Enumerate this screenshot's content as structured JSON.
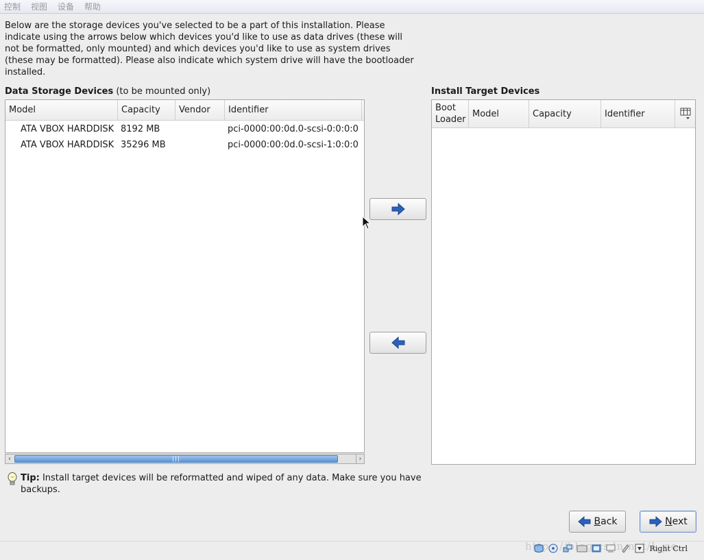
{
  "menu": [
    "控制",
    "视图",
    "设备",
    "帮助"
  ],
  "intro_text": "Below are the storage devices you've selected to be a part of this installation.  Please indicate using the arrows below which devices you'd like to use as data drives (these will not be formatted, only mounted) and which devices you'd like to use as system drives (these may be formatted).  Please also indicate which system drive will have the bootloader installed.",
  "data_storage": {
    "title": "Data Storage Devices",
    "subtitle": "(to be mounted only)",
    "columns": [
      "Model",
      "Capacity",
      "Vendor",
      "Identifier"
    ],
    "rows": [
      {
        "model": "ATA VBOX HARDDISK",
        "capacity": "8192 MB",
        "vendor": "",
        "identifier": "pci-0000:00:0d.0-scsi-0:0:0:0"
      },
      {
        "model": "ATA VBOX HARDDISK",
        "capacity": "35296 MB",
        "vendor": "",
        "identifier": "pci-0000:00:0d.0-scsi-1:0:0:0"
      }
    ]
  },
  "install_target": {
    "title": "Install Target Devices",
    "columns": [
      "Boot Loader",
      "Model",
      "Capacity",
      "Identifier"
    ],
    "rows": []
  },
  "tip": {
    "label": "Tip:",
    "text": " Install target devices will be reformatted and wiped of any data.  Make sure you have backups."
  },
  "buttons": {
    "back_mnemonic": "B",
    "back_rest": "ack",
    "next_mnemonic": "N",
    "next_rest": "ext"
  },
  "statusbar": {
    "host_key": "Right Ctrl",
    "watermark": "https://blog.csdn.net/L_co"
  },
  "colors": {
    "arrow_blue": "#2b62b8",
    "scroll_thumb": "#5b94d6"
  }
}
